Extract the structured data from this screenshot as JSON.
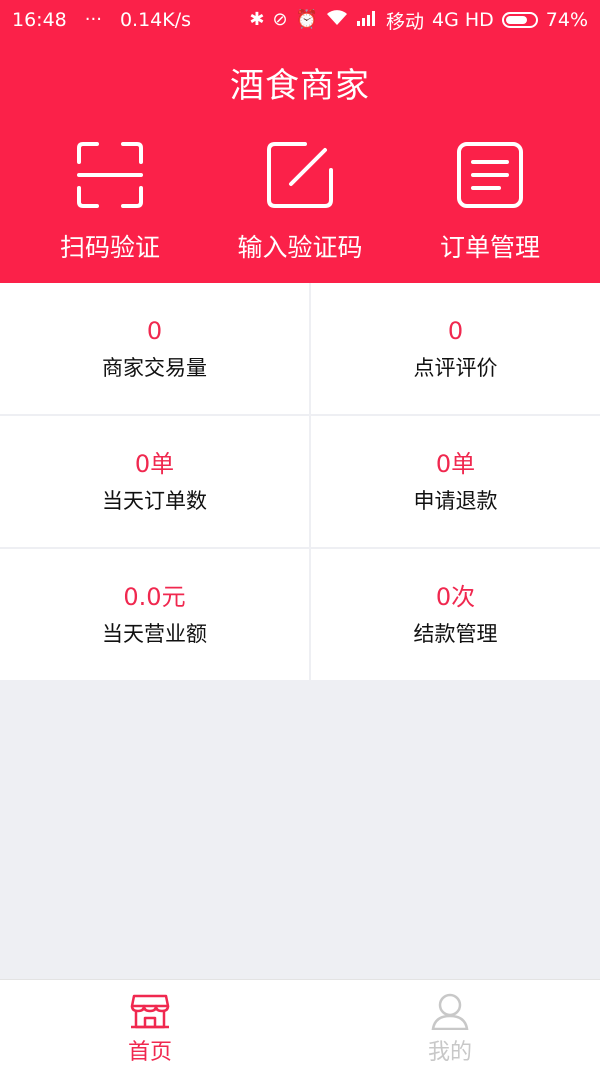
{
  "status_bar": {
    "time": "16:48",
    "speed": "0.14K/s",
    "carrier": "移动",
    "network": "4G HD",
    "battery": "74%",
    "battery_level": 0.74
  },
  "header": {
    "title": "酒食商家",
    "actions": [
      {
        "label": "扫码验证",
        "icon": "scan-icon"
      },
      {
        "label": "输入验证码",
        "icon": "edit-icon"
      },
      {
        "label": "订单管理",
        "icon": "order-list-icon"
      }
    ]
  },
  "stats": [
    {
      "value": "0",
      "label": "商家交易量"
    },
    {
      "value": "0",
      "label": "点评评价"
    },
    {
      "value": "0单",
      "label": "当天订单数"
    },
    {
      "value": "0单",
      "label": "申请退款"
    },
    {
      "value": "0.0元",
      "label": "当天营业额"
    },
    {
      "value": "0次",
      "label": "结款管理"
    }
  ],
  "tabbar": {
    "items": [
      {
        "label": "首页",
        "icon": "store-icon",
        "active": true
      },
      {
        "label": "我的",
        "icon": "user-icon",
        "active": false
      }
    ]
  },
  "colors": {
    "brand": "#fb2149",
    "accent_text": "#f0284f",
    "background": "#eeeff3",
    "inactive": "#c8c8c8"
  }
}
